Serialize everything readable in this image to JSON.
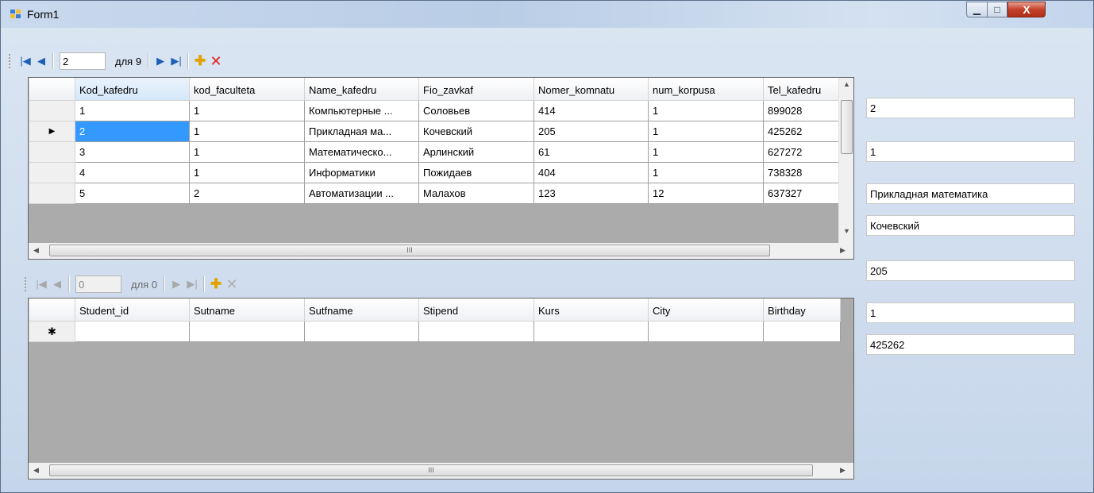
{
  "window": {
    "title": "Form1",
    "controls": {
      "minimize": "▁",
      "maximize": "□",
      "close": "X"
    }
  },
  "nav1": {
    "position": "2",
    "count_label": "для 9",
    "icons": [
      "first-record-icon",
      "prev-record-icon",
      "next-record-icon",
      "last-record-icon",
      "add-record-icon",
      "delete-record-icon"
    ]
  },
  "grid1": {
    "columns": [
      "Kod_kafedru",
      "kod_faculteta",
      "Name_kafedru",
      "Fio_zavkaf",
      "Nomer_komnatu",
      "num_korpusa",
      "Tel_kafedru"
    ],
    "rows": [
      [
        "1",
        "1",
        "Компьютерные ...",
        "Соловьев",
        "414",
        "1",
        "899028"
      ],
      [
        "2",
        "1",
        "Прикладная ма...",
        "Кочевский",
        "205",
        "1",
        "425262"
      ],
      [
        "3",
        "1",
        "Математическо...",
        "Арлинский",
        "61",
        "1",
        "627272"
      ],
      [
        "4",
        "1",
        "Информатики",
        "Пожидаев",
        "404",
        "1",
        "738328"
      ],
      [
        "5",
        "2",
        "Автоматизации ...",
        "Малахов",
        "123",
        "12",
        "637327"
      ]
    ],
    "current_row_indicator": "▶",
    "selected_row": 1,
    "selected_cell_color": "#3399ff"
  },
  "nav2": {
    "position": "0",
    "count_label": "для 0"
  },
  "grid2": {
    "columns": [
      "Student_id",
      "Sutname",
      "Sutfname",
      "Stipend",
      "Kurs",
      "City",
      "Birthday"
    ],
    "new_row_indicator": "✱"
  },
  "details": {
    "kod_kafedru": "2",
    "kod_faculteta": "1",
    "name_kafedru": "Прикладная математика",
    "fio_zavkaf": "Кочевский",
    "nomer_komnatu": "205",
    "num_korpusa": "1",
    "tel_kafedru": "425262"
  },
  "scroll_glyph": "III"
}
